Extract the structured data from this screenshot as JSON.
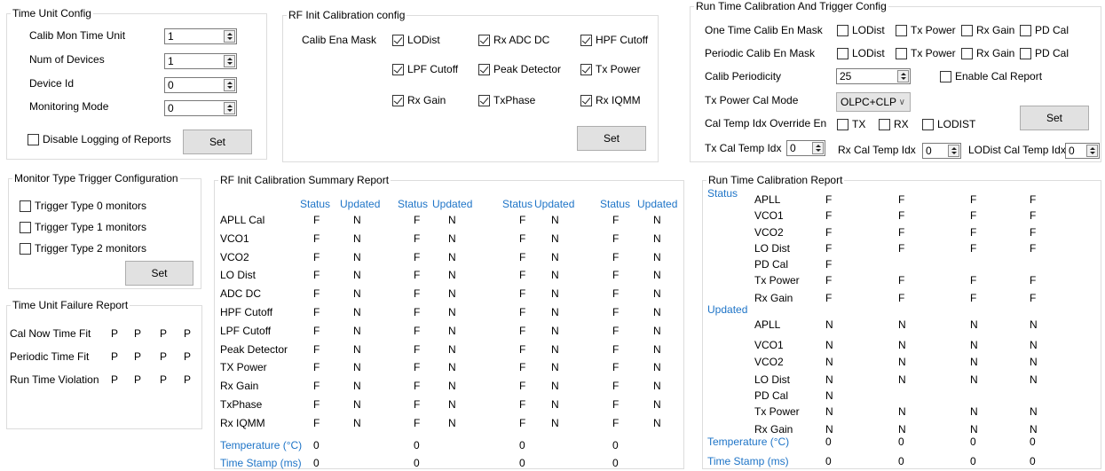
{
  "time_unit_config": {
    "title": "Time Unit Config",
    "calib_mon_label": "Calib Mon Time Unit",
    "calib_mon_value": "1",
    "num_devices_label": "Num of  Devices",
    "num_devices_value": "1",
    "device_id_label": "Device Id",
    "device_id_value": "0",
    "monitoring_mode_label": "Monitoring Mode",
    "monitoring_mode_value": "0",
    "disable_logging_label": "Disable Logging of Reports",
    "set_label": "Set"
  },
  "rf_init_config": {
    "title": "RF Init Calibration config",
    "mask_label": "Calib Ena Mask",
    "items": [
      {
        "label": "LODist",
        "checked": true
      },
      {
        "label": "Rx ADC DC",
        "checked": true
      },
      {
        "label": "HPF Cutoff",
        "checked": true
      },
      {
        "label": "LPF Cutoff",
        "checked": true
      },
      {
        "label": "Peak Detector",
        "checked": true
      },
      {
        "label": "Tx Power",
        "checked": true
      },
      {
        "label": "Rx Gain",
        "checked": true
      },
      {
        "label": "TxPhase",
        "checked": true
      },
      {
        "label": "Rx IQMM",
        "checked": true
      }
    ],
    "set_label": "Set"
  },
  "runtime_config": {
    "title": "Run Time Calibration And Trigger Config",
    "one_time_label": "One Time Calib En Mask",
    "periodic_label": "Periodic Calib En Mask",
    "mask_items": [
      "LODist",
      "Tx Power",
      "Rx Gain",
      "PD Cal"
    ],
    "periodicity_label": "Calib Periodicity",
    "periodicity_value": "25",
    "enable_report_label": "Enable Cal Report",
    "tx_power_mode_label": "Tx Power Cal Mode",
    "tx_power_mode_value": "OLPC+CLP",
    "temp_override_label": "Cal Temp Idx Override En",
    "override_items": [
      "TX",
      "RX",
      "LODIST"
    ],
    "set_label": "Set",
    "tx_temp_label": "Tx Cal Temp Idx",
    "tx_temp_value": "0",
    "rx_temp_label": "Rx Cal Temp Idx",
    "rx_temp_value": "0",
    "lodist_temp_label": "LODist Cal Temp Idx",
    "lodist_temp_value": "0"
  },
  "monitor_trigger": {
    "title": "Monitor Type Trigger Configuration",
    "items": [
      "Trigger Type 0 monitors",
      "Trigger Type 1 monitors",
      "Trigger Type 2 monitors"
    ],
    "set_label": "Set"
  },
  "time_unit_failure": {
    "title": "Time Unit Failure Report",
    "rows": [
      {
        "label": "Cal Now Time Fit",
        "values": [
          "P",
          "P",
          "P",
          "P"
        ]
      },
      {
        "label": "Periodic Time Fit",
        "values": [
          "P",
          "P",
          "P",
          "P"
        ]
      },
      {
        "label": "Run Time Violation",
        "values": [
          "P",
          "P",
          "P",
          "P"
        ]
      }
    ]
  },
  "rf_init_summary": {
    "title": "RF Init Calibration Summary Report",
    "headers": [
      "Status",
      "Updated",
      "Status",
      "Updated",
      "Status",
      "Updated",
      "Status",
      "Updated"
    ],
    "rows": [
      {
        "label": "APLL Cal",
        "values": [
          "F",
          "N",
          "F",
          "N",
          "F",
          "N",
          "F",
          "N"
        ]
      },
      {
        "label": "VCO1",
        "values": [
          "F",
          "N",
          "F",
          "N",
          "F",
          "N",
          "F",
          "N"
        ]
      },
      {
        "label": "VCO2",
        "values": [
          "F",
          "N",
          "F",
          "N",
          "F",
          "N",
          "F",
          "N"
        ]
      },
      {
        "label": "LO Dist",
        "values": [
          "F",
          "N",
          "F",
          "N",
          "F",
          "N",
          "F",
          "N"
        ]
      },
      {
        "label": "ADC DC",
        "values": [
          "F",
          "N",
          "F",
          "N",
          "F",
          "N",
          "F",
          "N"
        ]
      },
      {
        "label": "HPF Cutoff",
        "values": [
          "F",
          "N",
          "F",
          "N",
          "F",
          "N",
          "F",
          "N"
        ]
      },
      {
        "label": "LPF Cutoff",
        "values": [
          "F",
          "N",
          "F",
          "N",
          "F",
          "N",
          "F",
          "N"
        ]
      },
      {
        "label": "Peak Detector",
        "values": [
          "F",
          "N",
          "F",
          "N",
          "F",
          "N",
          "F",
          "N"
        ]
      },
      {
        "label": "TX Power",
        "values": [
          "F",
          "N",
          "F",
          "N",
          "F",
          "N",
          "F",
          "N"
        ]
      },
      {
        "label": "Rx Gain",
        "values": [
          "F",
          "N",
          "F",
          "N",
          "F",
          "N",
          "F",
          "N"
        ]
      },
      {
        "label": "TxPhase",
        "values": [
          "F",
          "N",
          "F",
          "N",
          "F",
          "N",
          "F",
          "N"
        ]
      },
      {
        "label": "Rx IQMM",
        "values": [
          "F",
          "N",
          "F",
          "N",
          "F",
          "N",
          "F",
          "N"
        ]
      }
    ],
    "temperature_label": "Temperature (°C)",
    "temperature_values": [
      "0",
      "0",
      "0",
      "0"
    ],
    "timestamp_label": "Time Stamp (ms)",
    "timestamp_values": [
      "0",
      "0",
      "0",
      "0"
    ]
  },
  "runtime_report": {
    "title": "Run Time Calibration Report",
    "status_label": "Status",
    "status_rows": [
      {
        "label": "APLL",
        "values": [
          "F",
          "F",
          "F",
          "F"
        ]
      },
      {
        "label": "VCO1",
        "values": [
          "F",
          "F",
          "F",
          "F"
        ]
      },
      {
        "label": "VCO2",
        "values": [
          "F",
          "F",
          "F",
          "F"
        ]
      },
      {
        "label": "LO Dist",
        "values": [
          "F",
          "F",
          "F",
          "F"
        ]
      },
      {
        "label": "PD Cal",
        "values": [
          "F"
        ]
      },
      {
        "label": "Tx Power",
        "values": [
          "F",
          "F",
          "F",
          "F"
        ]
      },
      {
        "label": "Rx Gain",
        "values": [
          "F",
          "F",
          "F",
          "F"
        ]
      }
    ],
    "updated_label": "Updated",
    "updated_rows": [
      {
        "label": "APLL",
        "values": [
          "N",
          "N",
          "N",
          "N"
        ]
      },
      {
        "label": "VCO1",
        "values": [
          "N",
          "N",
          "N",
          "N"
        ]
      },
      {
        "label": "VCO2",
        "values": [
          "N",
          "N",
          "N",
          "N"
        ]
      },
      {
        "label": "LO Dist",
        "values": [
          "N",
          "N",
          "N",
          "N"
        ]
      },
      {
        "label": "PD Cal",
        "values": [
          "N"
        ]
      },
      {
        "label": "Tx Power",
        "values": [
          "N",
          "N",
          "N",
          "N"
        ]
      },
      {
        "label": "Rx Gain",
        "values": [
          "N",
          "N",
          "N",
          "N"
        ]
      }
    ],
    "temperature_label": "Temperature (°C)",
    "temperature_values": [
      "0",
      "0",
      "0",
      "0"
    ],
    "timestamp_label": "Time Stamp (ms)",
    "timestamp_values": [
      "0",
      "0",
      "0",
      "0"
    ]
  }
}
